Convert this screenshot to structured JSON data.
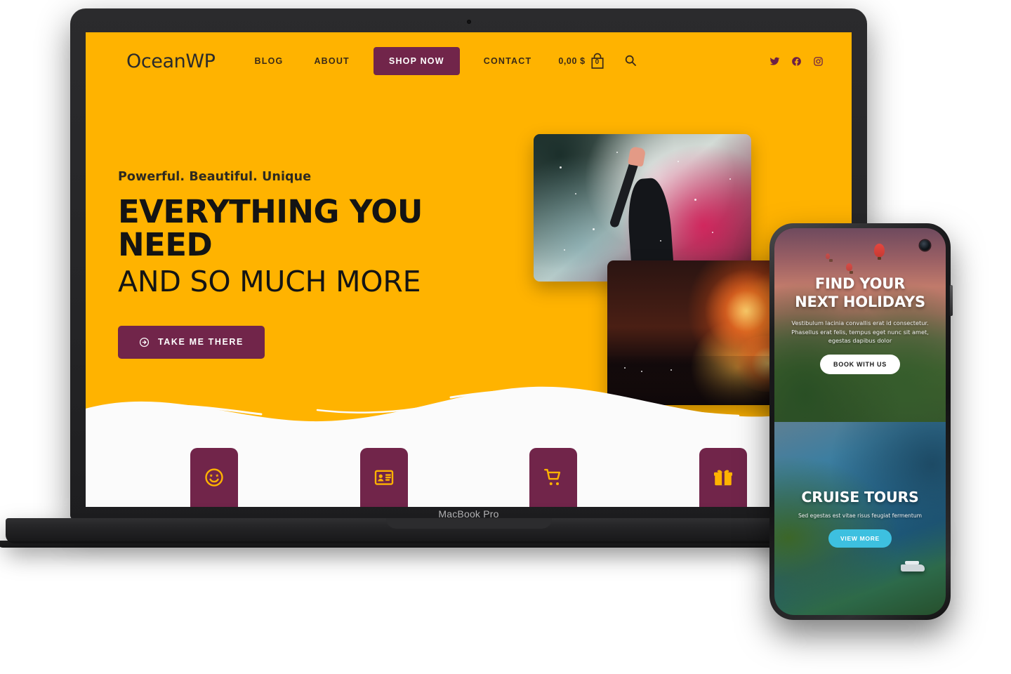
{
  "device_labels": {
    "laptop": "MacBook Pro"
  },
  "colors": {
    "brand_orange": "#ffb300",
    "brand_maroon": "#71254a",
    "text_dark": "#141414",
    "white": "#ffffff",
    "accent_blue": "#3dc0e0"
  },
  "site": {
    "logo": {
      "name": "OceanWP",
      "dot": "."
    },
    "nav": [
      {
        "label": "BLOG"
      },
      {
        "label": "ABOUT"
      }
    ],
    "shop_button": "SHOP NOW",
    "nav_after": [
      {
        "label": "CONTACT"
      }
    ],
    "cart": {
      "amount": "0,00 $",
      "count": "0",
      "icon": "shopping-bag-icon"
    },
    "search_icon": "search-icon",
    "socials": [
      {
        "name": "twitter-icon"
      },
      {
        "name": "facebook-icon"
      },
      {
        "name": "instagram-icon"
      }
    ],
    "hero": {
      "eyebrow": "Powerful. Beautiful. Unique",
      "title_line1": "EVERYTHING YOU NEED",
      "title_line2": "AND SO MUCH MORE",
      "cta": "TAKE ME THERE",
      "cta_icon": "arrow-right-circle-icon"
    },
    "photos": [
      {
        "name": "concert-photo",
        "alt": "Person raising hand in colored smoke at a festival"
      },
      {
        "name": "fireworks-photo",
        "alt": "Fireworks over a lake at night"
      }
    ],
    "feature_cards": [
      {
        "icon": "star-struck-smiley-icon"
      },
      {
        "icon": "id-card-icon"
      },
      {
        "icon": "shopping-cart-icon"
      },
      {
        "icon": "gift-box-icon"
      }
    ]
  },
  "phone": {
    "top_slide": {
      "title_line1": "FIND YOUR",
      "title_line2": "NEXT HOLIDAYS",
      "body": "Vestibulum lacinia convallis erat id consectetur. Phasellus erat felis, tempus eget nunc sit amet, egestas dapibus dolor",
      "button": "BOOK WITH US"
    },
    "bottom_slide": {
      "title": "CRUISE TOURS",
      "body": "Sed egestas est vitae risus feugiat fermentum",
      "button": "VIEW MORE"
    }
  }
}
